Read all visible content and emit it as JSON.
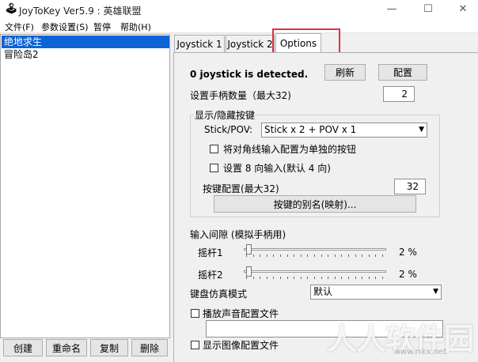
{
  "window": {
    "title": "JoyToKey Ver5.9 : 英雄联盟",
    "icon": "joystick-icon",
    "controls": [
      "—",
      "☐",
      "✕"
    ]
  },
  "menu": [
    "文件(F)",
    "参数设置(S)",
    "暂停",
    "帮助(H)"
  ],
  "configs": [
    "绝地求生",
    "冒险岛2"
  ],
  "left_buttons": [
    "创建",
    "重命名",
    "复制",
    "删除"
  ],
  "tabs": [
    "Joystick 1",
    "Joystick 2",
    "Options"
  ],
  "options": {
    "status": "0 joystick is detected.",
    "refresh": "刷新",
    "config": "配置",
    "joystick_count_label": "设置手柄数量（最大32)",
    "joystick_count": "2",
    "group_title": "显示/隐藏按键",
    "stickpov_label": "Stick/POV:",
    "stickpov_value": "Stick x 2 + POV x 1",
    "diag_label": "将对角线输入配置为单独的按钮",
    "eight_dir_label": "设置 8 向输入(默认 4 向)",
    "button_count_label": "按键配置(最大32)",
    "button_count": "32",
    "alias_button": "按键的别名(映射)...",
    "interval_label": "输入间隙 (模拟手柄用)",
    "stick1_label": "摇杆1",
    "stick1_value": "2 %",
    "stick1_level": 2,
    "stick2_label": "摇杆2",
    "stick2_value": "2 %",
    "stick2_level": 2,
    "keyboard_mode_label": "键盘仿真模式",
    "keyboard_mode_value": "默认",
    "play_sound_label": "播放声音配置文件",
    "show_image_label": "显示图像配置文件"
  },
  "watermark": {
    "text": "人人软件园",
    "url": "www.rrkx.net"
  }
}
